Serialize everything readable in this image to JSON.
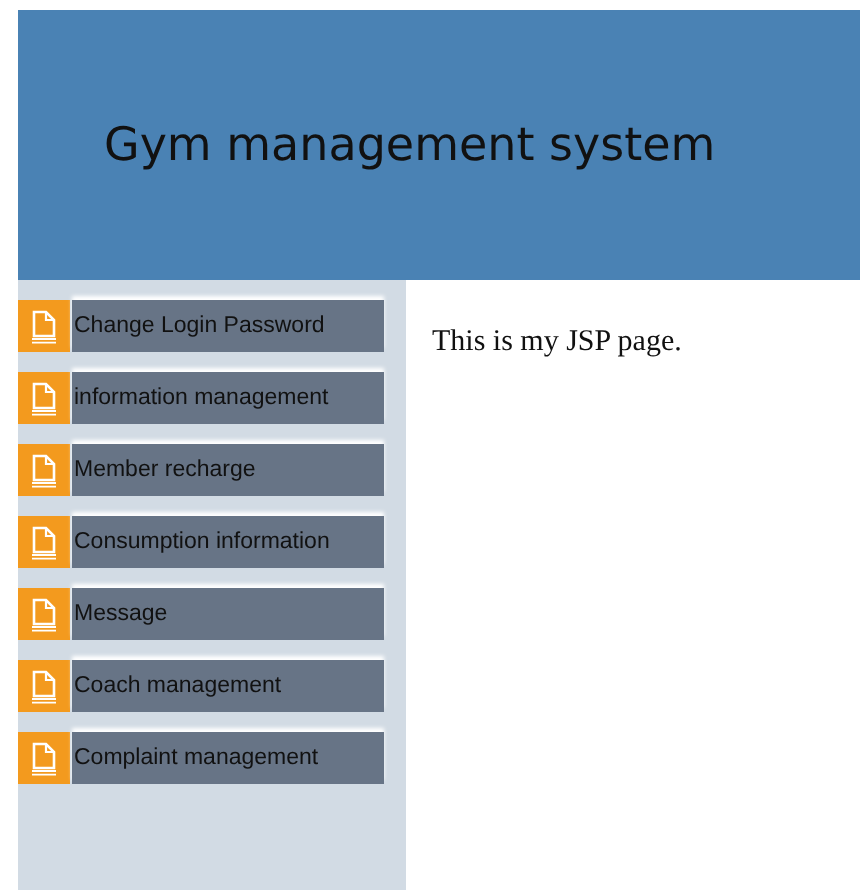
{
  "header": {
    "title": "Gym management system"
  },
  "sidebar": {
    "items": [
      {
        "label": "Change Login Password"
      },
      {
        "label": "information management"
      },
      {
        "label": "Member recharge"
      },
      {
        "label": "Consumption information"
      },
      {
        "label": "Message"
      },
      {
        "label": "Coach management"
      },
      {
        "label": "Complaint management"
      }
    ]
  },
  "main": {
    "text": "This is my JSP page."
  }
}
